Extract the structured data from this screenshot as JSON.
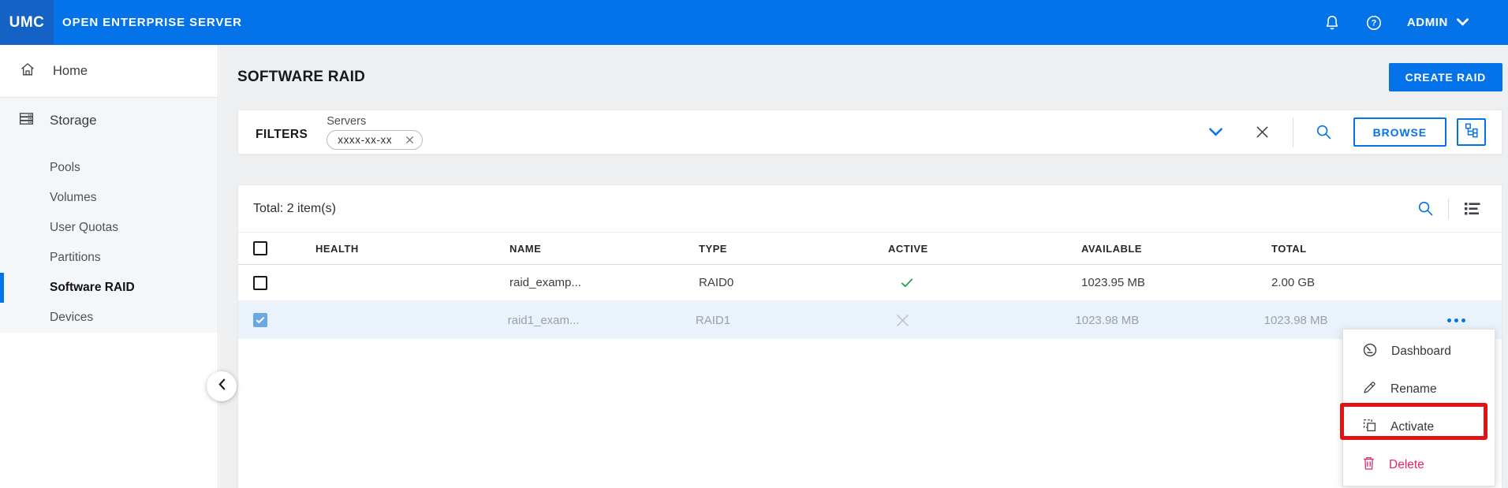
{
  "topbar": {
    "logo": "UMC",
    "product": "OPEN ENTERPRISE SERVER",
    "user": "ADMIN"
  },
  "sidebar": {
    "home_label": "Home",
    "group_label": "Storage",
    "items": [
      {
        "label": "Pools",
        "active": false
      },
      {
        "label": "Volumes",
        "active": false
      },
      {
        "label": "User Quotas",
        "active": false
      },
      {
        "label": "Partitions",
        "active": false
      },
      {
        "label": "Software RAID",
        "active": true
      },
      {
        "label": "Devices",
        "active": false
      }
    ]
  },
  "page": {
    "title": "SOFTWARE RAID",
    "create_button": "CREATE RAID"
  },
  "filters": {
    "label": "FILTERS",
    "field_label": "Servers",
    "chip_value": "xxxx-xx-xx",
    "browse_button": "BROWSE"
  },
  "table": {
    "total_label": "Total: 2 item(s)",
    "columns": [
      "HEALTH",
      "NAME",
      "TYPE",
      "ACTIVE",
      "AVAILABLE",
      "TOTAL"
    ],
    "rows": [
      {
        "name": "raid_examp...",
        "type": "RAID0",
        "health": "good",
        "active": true,
        "available": "1023.95 MB",
        "total": "2.00 GB",
        "selected": false
      },
      {
        "name": "raid1_exam...",
        "type": "RAID1",
        "health": "good-inactive",
        "active": false,
        "available": "1023.98 MB",
        "total": "1023.98 MB",
        "selected": true
      }
    ]
  },
  "menu": {
    "items": [
      {
        "label": "Dashboard",
        "highlighted": false,
        "danger": false
      },
      {
        "label": "Rename",
        "highlighted": false,
        "danger": false
      },
      {
        "label": "Activate",
        "highlighted": true,
        "danger": false
      },
      {
        "label": "Delete",
        "highlighted": false,
        "danger": true
      }
    ]
  },
  "colors": {
    "accent": "#0473e9",
    "header_bar": "#0473e9",
    "logo_box": "#1562c6",
    "danger": "#e5255f",
    "annotation": "#e21313",
    "health_ok": "#1fad4e",
    "health_ok_faded": "#8ad3a2",
    "selected_row_bg": "#eaf3fc",
    "checked_checkbox": "#6aa7e4"
  }
}
